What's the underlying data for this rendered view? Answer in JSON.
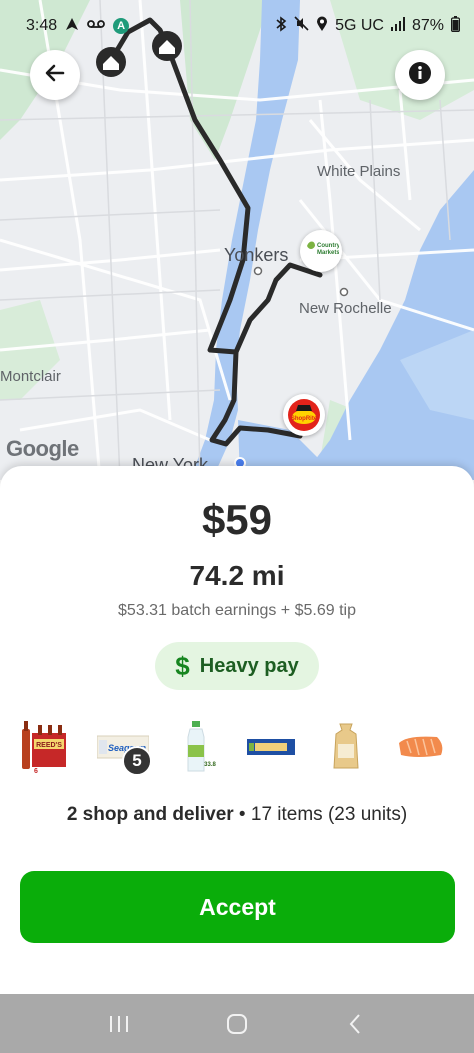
{
  "status_bar": {
    "time": "3:48",
    "network": "5G UC",
    "battery": "87%"
  },
  "map": {
    "labels": {
      "white_plains": "White Plains",
      "yonkers": "Yonkers",
      "new_rochelle": "New Rochelle",
      "montclair": "Montclair",
      "new_york": "New York"
    },
    "attribution": "Google",
    "stores": {
      "country_markets": "Country Markets",
      "shoprite": "ShopRite"
    }
  },
  "offer": {
    "price": "$59",
    "distance": "74.2 mi",
    "earnings_detail": "$53.31 batch earnings + $5.69 tip",
    "badge_icon": "$",
    "badge_label": "Heavy pay",
    "product_quantity": "5",
    "summary_bold": "2 shop and deliver",
    "summary_separator": " • ",
    "summary_rest": "17 items (23 units)",
    "accept_label": "Accept"
  },
  "colors": {
    "accent_green": "#0aad0a",
    "badge_bg": "#e4f5e1",
    "route": "#2a2a2a"
  }
}
